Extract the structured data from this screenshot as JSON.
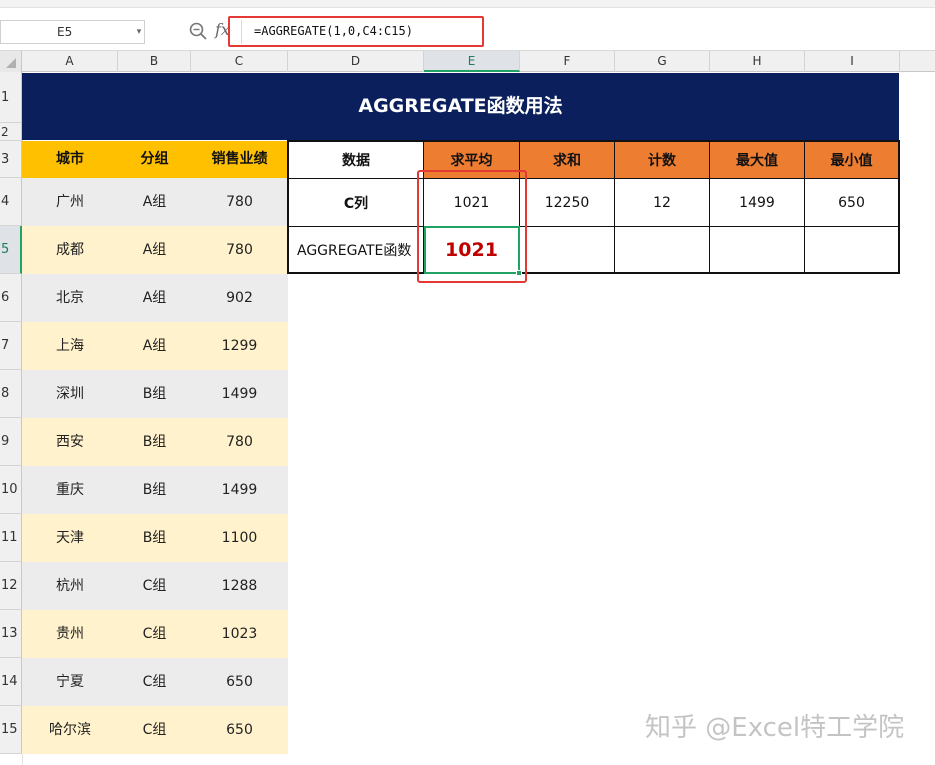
{
  "formula_bar": {
    "name_box": "E5",
    "fx_label": "fx",
    "formula": "=AGGREGATE(1,0,C4:C15)"
  },
  "columns": [
    "A",
    "B",
    "C",
    "D",
    "E",
    "F",
    "G",
    "H",
    "I"
  ],
  "rows": [
    "1",
    "2",
    "3",
    "4",
    "5",
    "6",
    "7",
    "8",
    "9",
    "10",
    "11",
    "12",
    "13",
    "14",
    "15"
  ],
  "selected_cell": {
    "column": "E",
    "row": "5"
  },
  "title": "AGGREGATE函数用法",
  "left_table": {
    "headers": [
      "城市",
      "分组",
      "销售业绩"
    ],
    "rows": [
      [
        "广州",
        "A组",
        "780"
      ],
      [
        "成都",
        "A组",
        "780"
      ],
      [
        "北京",
        "A组",
        "902"
      ],
      [
        "上海",
        "A组",
        "1299"
      ],
      [
        "深圳",
        "B组",
        "1499"
      ],
      [
        "西安",
        "B组",
        "780"
      ],
      [
        "重庆",
        "B组",
        "1499"
      ],
      [
        "天津",
        "B组",
        "1100"
      ],
      [
        "杭州",
        "C组",
        "1288"
      ],
      [
        "贵州",
        "C组",
        "1023"
      ],
      [
        "宁夏",
        "C组",
        "650"
      ],
      [
        "哈尔滨",
        "C组",
        "650"
      ]
    ]
  },
  "right_table": {
    "headers": [
      "数据",
      "求平均",
      "求和",
      "计数",
      "最大值",
      "最小值"
    ],
    "row_c": [
      "C列",
      "1021",
      "12250",
      "12",
      "1499",
      "650"
    ],
    "row_agg": [
      "AGGREGATE函数",
      "1021",
      "",
      "",
      "",
      ""
    ]
  },
  "colors": {
    "title_bg": "#0a1f5c",
    "left_header_bg": "#ffc000",
    "right_header_bg": "#ed7d31",
    "row_grey": "#ececec",
    "row_cream": "#fff2cc",
    "highlight_red": "#e53935",
    "active_green": "#21a366",
    "agg_value": "#c00000"
  },
  "watermark": "知乎 @Excel特工学院"
}
